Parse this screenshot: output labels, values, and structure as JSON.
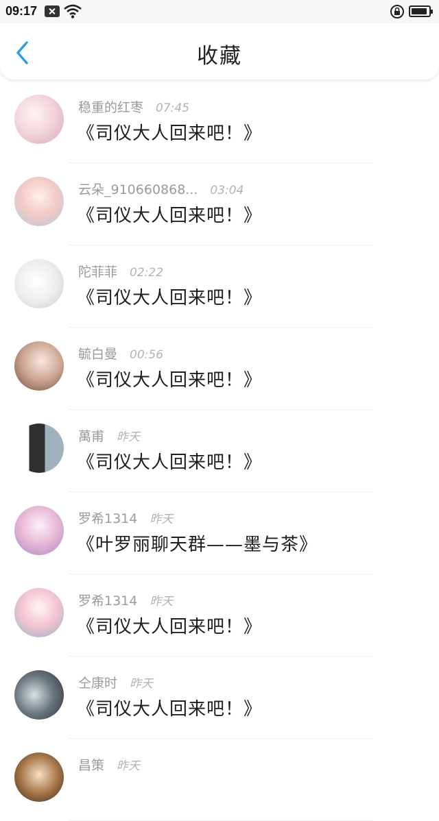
{
  "status_bar": {
    "time": "09:17",
    "battery_level_percent": 90
  },
  "header": {
    "title": "收藏"
  },
  "colors": {
    "accent": "#2a9ee8",
    "text_primary": "#1e1e1e",
    "text_secondary": "#9a9a9a"
  },
  "favorites": [
    {
      "username": "稳重的红枣",
      "time": "07:45",
      "title": "《司仪大人回来吧！》"
    },
    {
      "username": "云朵_910660868...",
      "time": "03:04",
      "title": "《司仪大人回来吧！》"
    },
    {
      "username": "陀菲菲",
      "time": "02:22",
      "title": "《司仪大人回来吧！》"
    },
    {
      "username": "毓白曼",
      "time": "00:56",
      "title": "《司仪大人回来吧！》"
    },
    {
      "username": "萬甫",
      "time": "昨天",
      "title": "《司仪大人回来吧！》"
    },
    {
      "username": "罗希1314",
      "time": "昨天",
      "title": "《叶罗丽聊天群——墨与茶》"
    },
    {
      "username": "罗希1314",
      "time": "昨天",
      "title": "《司仪大人回来吧！》"
    },
    {
      "username": "仝康时",
      "time": "昨天",
      "title": "《司仪大人回来吧！》"
    },
    {
      "username": "昌策",
      "time": "昨天",
      "title": ""
    }
  ]
}
